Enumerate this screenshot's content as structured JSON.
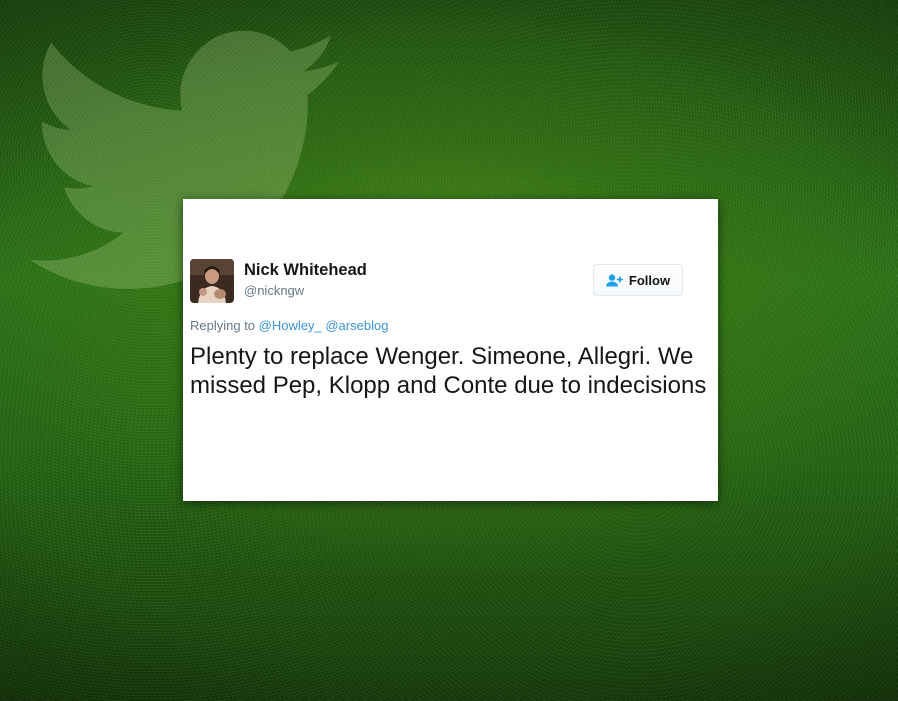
{
  "tweet": {
    "user": {
      "name": "Nick Whitehead",
      "handle": "@nickngw"
    },
    "follow_label": "Follow",
    "replying_to_label": "Replying to",
    "mentions": [
      "@Howley_",
      "@arseblog"
    ],
    "text": "Plenty to replace Wenger. Simeone, Allegri. We missed Pep, Klopp and Conte due to indecisions"
  },
  "icons": {
    "background": "twitter-bird-icon",
    "follow": "add-user-icon"
  },
  "colors": {
    "mention": "#3b94d9",
    "follow_icon": "#1da1f2",
    "muted_text": "#657786",
    "primary_text": "#14171a"
  }
}
